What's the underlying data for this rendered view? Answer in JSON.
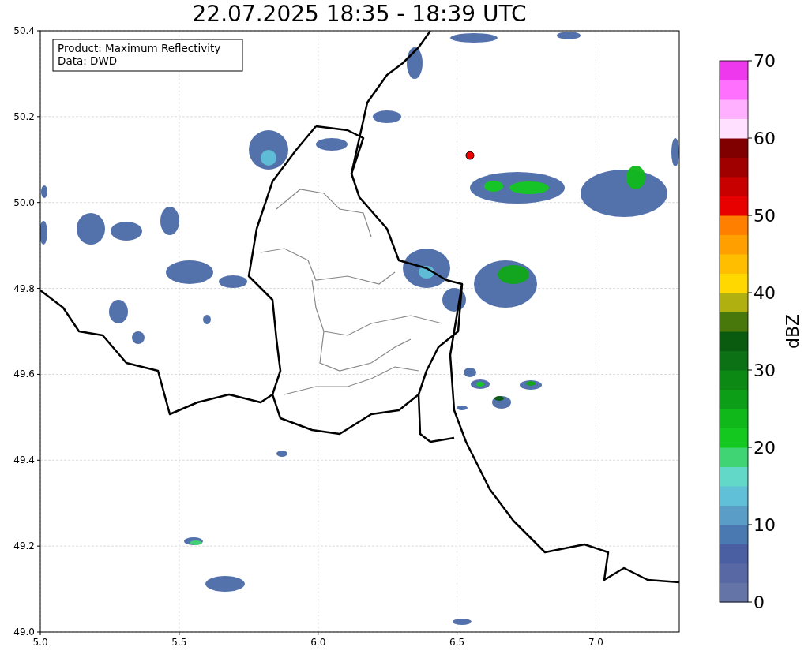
{
  "title": "22.07.2025 18:35 - 18:39 UTC",
  "map": {
    "legend": [
      "Product: Maximum Reflectivity",
      "Data: DWD"
    ],
    "x_ticks": [
      "5.0",
      "5.5",
      "6.0",
      "6.5",
      "7.0"
    ],
    "y_ticks": [
      "50.4",
      "50.2",
      "50.0",
      "49.8",
      "49.6",
      "49.4",
      "49.2",
      "49.0"
    ]
  },
  "colorbar": {
    "label": "dBZ",
    "ticks": [
      "70",
      "60",
      "50",
      "40",
      "30",
      "20",
      "10",
      "0"
    ],
    "segments": [
      {
        "color": "#6474a6"
      },
      {
        "color": "#5868a4"
      },
      {
        "color": "#4a5ea2"
      },
      {
        "color": "#4a78b0"
      },
      {
        "color": "#5a9ec8"
      },
      {
        "color": "#60c0d8"
      },
      {
        "color": "#62d8c8"
      },
      {
        "color": "#40d474"
      },
      {
        "color": "#14c820"
      },
      {
        "color": "#10b81a"
      },
      {
        "color": "#0c9e16"
      },
      {
        "color": "#0c8814"
      },
      {
        "color": "#0c7014"
      },
      {
        "color": "#0a5a10"
      },
      {
        "color": "#48780c"
      },
      {
        "color": "#b0b010"
      },
      {
        "color": "#ffd800"
      },
      {
        "color": "#ffbe00"
      },
      {
        "color": "#ffa000"
      },
      {
        "color": "#ff8000"
      },
      {
        "color": "#e80000"
      },
      {
        "color": "#c80000"
      },
      {
        "color": "#a00000"
      },
      {
        "color": "#800000"
      },
      {
        "color": "#ffe0ff"
      },
      {
        "color": "#ffb0ff"
      },
      {
        "color": "#ff70ff"
      },
      {
        "color": "#ee38ee"
      }
    ]
  }
}
